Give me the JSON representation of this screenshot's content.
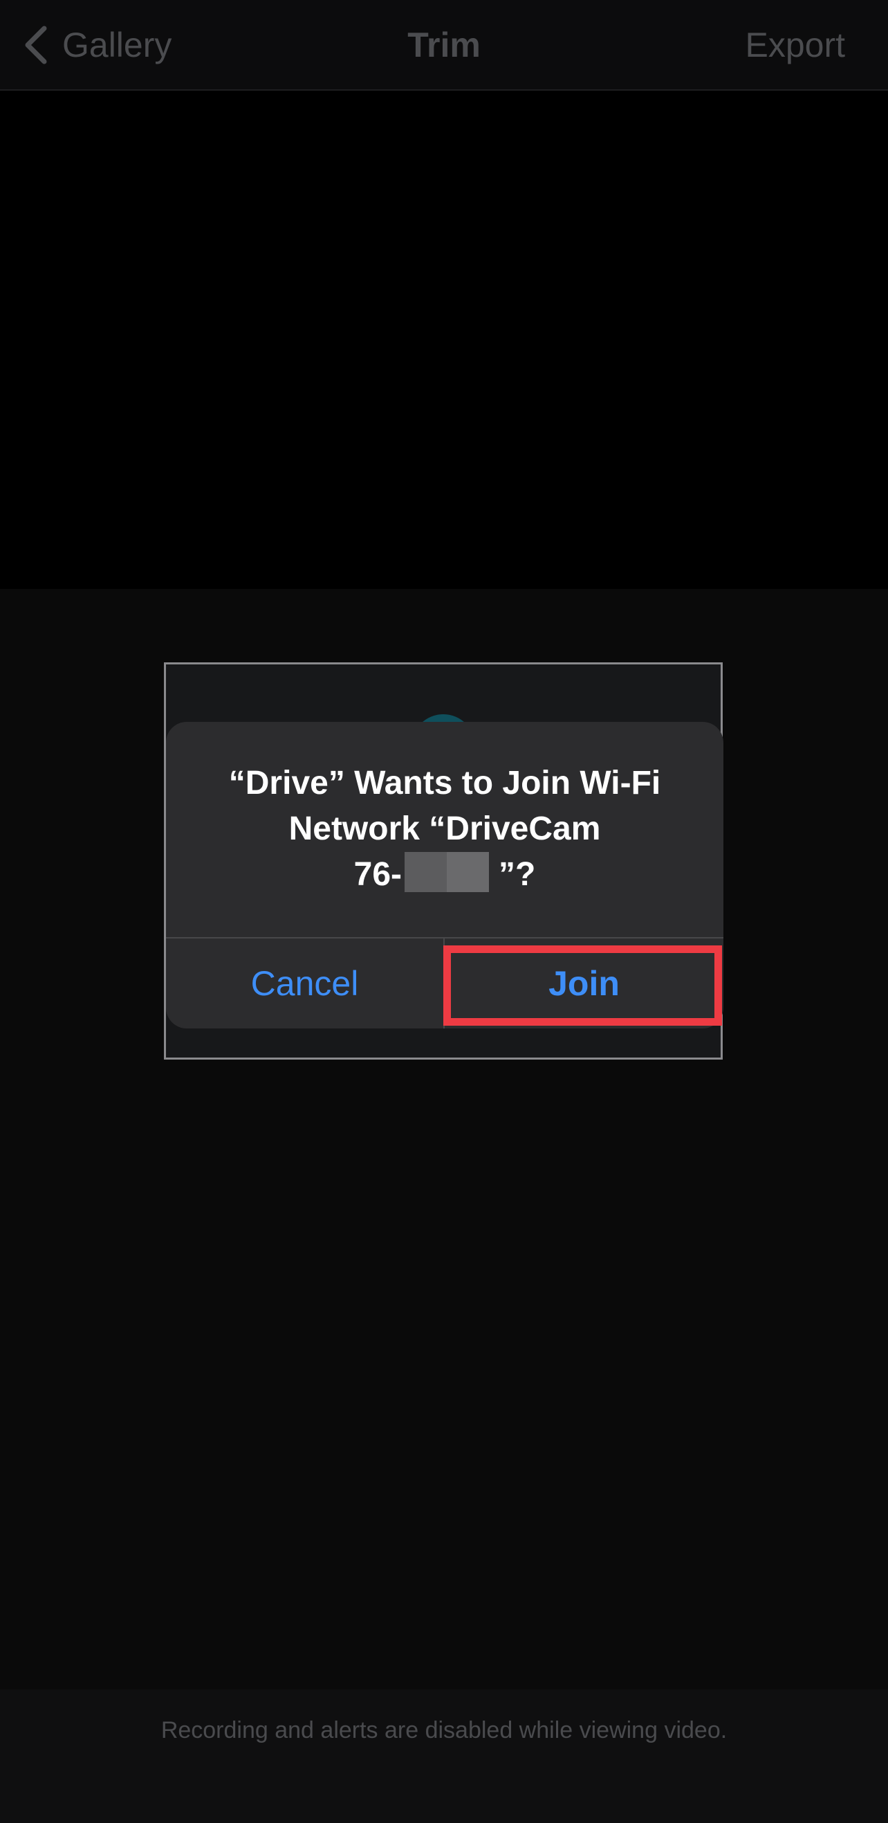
{
  "navbar": {
    "back_label": "Gallery",
    "title": "Trim",
    "export_label": "Export"
  },
  "alert": {
    "title_line1": "“Drive” Wants to Join Wi-Fi",
    "title_line2": "Network “DriveCam",
    "title_line3_prefix": "76-",
    "title_line3_suffix": "”?",
    "cancel_label": "Cancel",
    "join_label": "Join",
    "accent_color": "#3e8ef7"
  },
  "annotation": {
    "highlight_color": "#ee3b43"
  },
  "footer": {
    "text": "Recording and alerts are disabled while viewing video."
  }
}
